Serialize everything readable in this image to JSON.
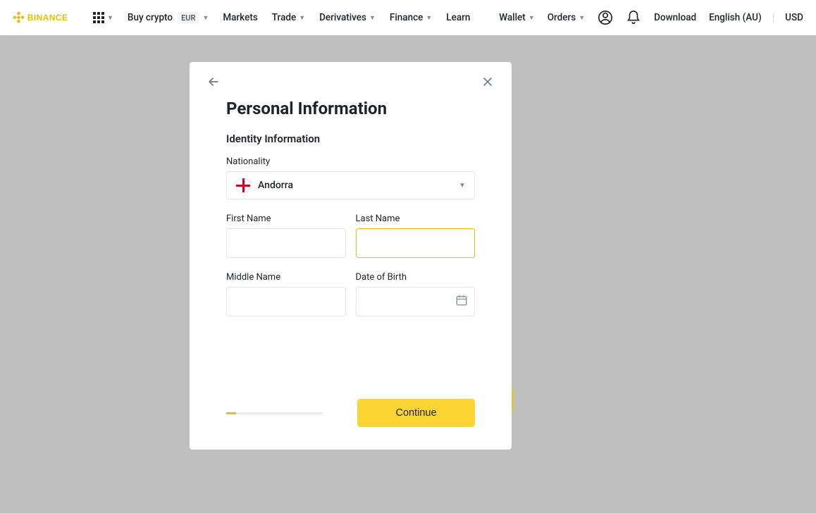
{
  "brand": "BINANCE",
  "nav": {
    "buy_crypto": "Buy crypto",
    "eur_badge": "EUR",
    "markets": "Markets",
    "trade": "Trade",
    "derivatives": "Derivatives",
    "finance": "Finance",
    "learn": "Learn",
    "wallet": "Wallet",
    "orders": "Orders",
    "download": "Download",
    "language": "English (AU)",
    "currency": "USD"
  },
  "modal": {
    "title": "Personal Information",
    "section": "Identity Information",
    "labels": {
      "nationality": "Nationality",
      "first_name": "First Name",
      "last_name": "Last Name",
      "middle_name": "Middle Name",
      "dob": "Date of Birth"
    },
    "nationality_value": "Andorra",
    "fields": {
      "first_name": "",
      "last_name": "",
      "middle_name": "",
      "dob": ""
    },
    "continue": "Continue",
    "progress_percent": 10
  },
  "colors": {
    "accent": "#f0b90b",
    "button": "#fcd535"
  }
}
